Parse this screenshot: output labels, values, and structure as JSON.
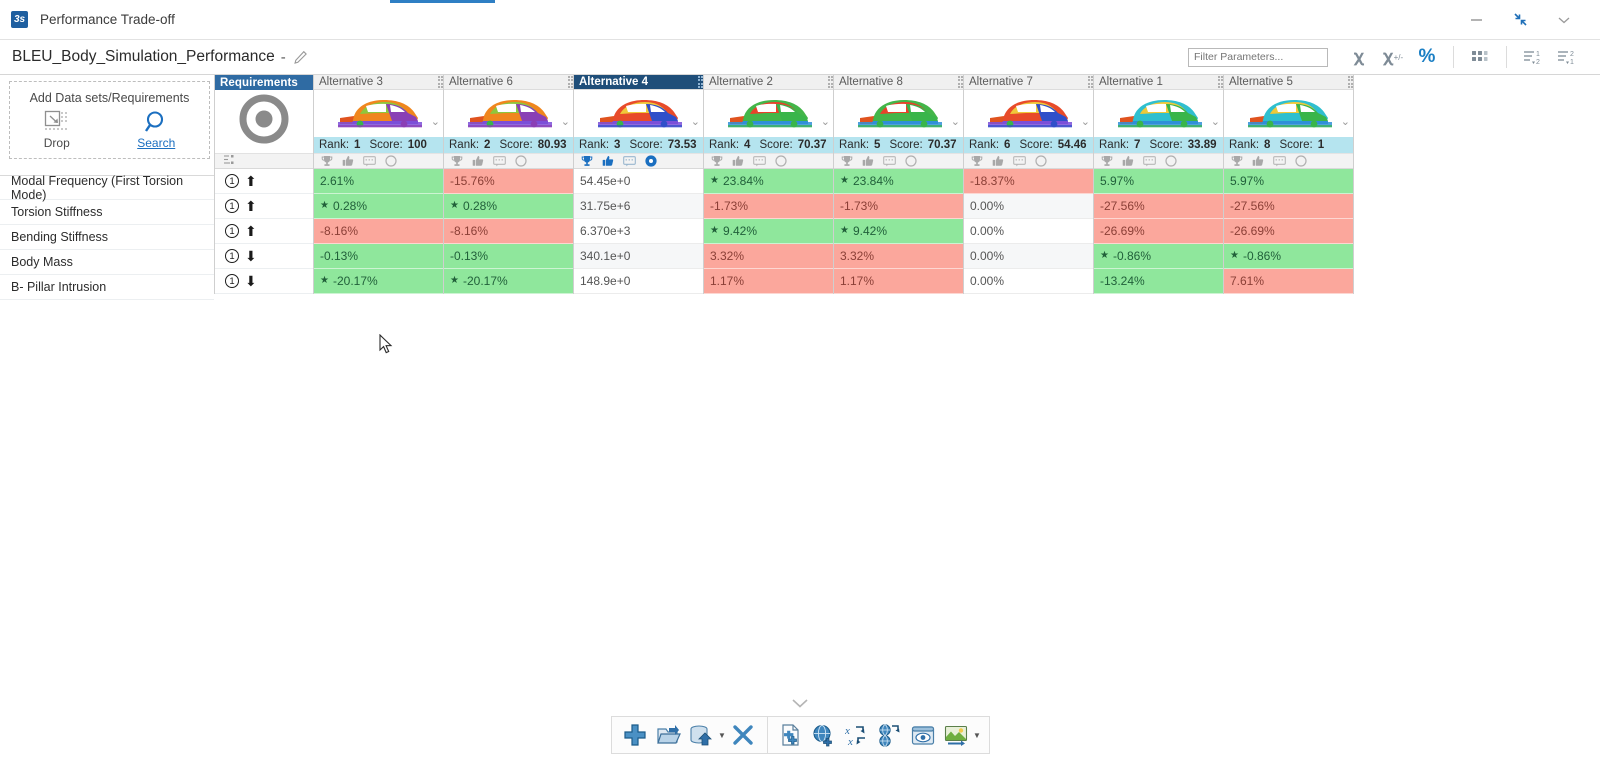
{
  "window": {
    "app_icon": "app-icon",
    "title": "Performance Trade-off",
    "controls": {
      "minimize": "minimize-icon",
      "restore": "restore-icon",
      "more": "chevron-down-icon"
    }
  },
  "document": {
    "title": "BLEU_Body_Simulation_Performance",
    "separator": "-",
    "edit_icon": "pencil-icon"
  },
  "toolbar": {
    "filter_placeholder": "Filter Parameters...",
    "filter_value": "",
    "buttons": [
      {
        "name": "show-absolute-values-button",
        "label": "χ",
        "active": false
      },
      {
        "name": "show-signed-values-button",
        "label": "χ",
        "sup": "+/-",
        "active": false
      },
      {
        "name": "show-percent-values-button",
        "label": "%",
        "active": true
      },
      {
        "name": "matrix-view-button",
        "label": "matrix-icon",
        "active": false
      },
      {
        "name": "sort-ascending-button",
        "label": "sort-asc-icon",
        "active": false
      },
      {
        "name": "sort-descending-button",
        "label": "sort-desc-icon",
        "active": false
      }
    ]
  },
  "dropzone": {
    "title": "Add Data sets/Requirements",
    "drop_label": "Drop",
    "drop_icon": "drop-target-icon",
    "search_label": "Search",
    "search_icon": "search-icon"
  },
  "requirements_column": {
    "header": "Requirements",
    "target_icon": "bullseye-target-icon",
    "legend_icon": "chart-legend-icon"
  },
  "parameters": [
    {
      "name": "Modal Frequency (First Torsion Mode)",
      "priority": "1",
      "direction": "up"
    },
    {
      "name": "Torsion Stiffness",
      "priority": "1",
      "direction": "up"
    },
    {
      "name": "Bending Stiffness",
      "priority": "1",
      "direction": "up"
    },
    {
      "name": "Body Mass",
      "priority": "1",
      "direction": "down"
    },
    {
      "name": "B- Pillar Intrusion",
      "priority": "1",
      "direction": "down"
    }
  ],
  "alternatives": [
    {
      "title": "Alternative 3",
      "rank_label": "Rank:",
      "rank": "1",
      "score_label": "Score:",
      "score": "100",
      "selected": false,
      "car_palette": [
        "#f0861e",
        "#8fc63d",
        "#8a3fb5",
        "#7b4fd8",
        "#e0531f",
        "#39b54a"
      ],
      "values": [
        {
          "text": "2.61%",
          "state": "pos",
          "star": false
        },
        {
          "text": "0.28%",
          "state": "pos",
          "star": true
        },
        {
          "text": "-8.16%",
          "state": "neg",
          "star": false
        },
        {
          "text": "-0.13%",
          "state": "pos",
          "star": false
        },
        {
          "text": "-20.17%",
          "state": "pos",
          "star": true
        }
      ]
    },
    {
      "title": "Alternative 6",
      "rank_label": "Rank:",
      "rank": "2",
      "score_label": "Score:",
      "score": "80.93",
      "selected": false,
      "car_palette": [
        "#f0861e",
        "#8fc63d",
        "#8a3fb5",
        "#7b4fd8",
        "#e0531f",
        "#39b54a"
      ],
      "values": [
        {
          "text": "-15.76%",
          "state": "neg",
          "star": false
        },
        {
          "text": "0.28%",
          "state": "pos",
          "star": true
        },
        {
          "text": "-8.16%",
          "state": "neg",
          "star": false
        },
        {
          "text": "-0.13%",
          "state": "pos",
          "star": false
        },
        {
          "text": "-20.17%",
          "state": "pos",
          "star": true
        }
      ]
    },
    {
      "title": "Alternative 4",
      "rank_label": "Rank:",
      "rank": "3",
      "score_label": "Score:",
      "score": "73.53",
      "selected": true,
      "car_palette": [
        "#e84b2a",
        "#efc93a",
        "#2f4fc9",
        "#7b4fd8",
        "#e0531f",
        "#39b54a"
      ],
      "values": [
        {
          "text": "54.45e+0",
          "state": "neutral",
          "star": false
        },
        {
          "text": "31.75e+6",
          "state": "neutral",
          "star": false
        },
        {
          "text": "6.370e+3",
          "state": "neutral",
          "star": false
        },
        {
          "text": "340.1e+0",
          "state": "neutral",
          "star": false
        },
        {
          "text": "148.9e+0",
          "state": "neutral",
          "star": false
        }
      ]
    },
    {
      "title": "Alternative 2",
      "rank_label": "Rank:",
      "rank": "4",
      "score_label": "Score:",
      "score": "70.37",
      "selected": false,
      "car_palette": [
        "#43b649",
        "#e8412a",
        "#39b54a",
        "#2f8fd8",
        "#e0531f",
        "#39b54a"
      ],
      "values": [
        {
          "text": "23.84%",
          "state": "pos",
          "star": true
        },
        {
          "text": "-1.73%",
          "state": "neg",
          "star": false
        },
        {
          "text": "9.42%",
          "state": "pos",
          "star": true
        },
        {
          "text": "3.32%",
          "state": "neg",
          "star": false
        },
        {
          "text": "1.17%",
          "state": "neg",
          "star": false
        }
      ]
    },
    {
      "title": "Alternative 8",
      "rank_label": "Rank:",
      "rank": "5",
      "score_label": "Score:",
      "score": "70.37",
      "selected": false,
      "car_palette": [
        "#43b649",
        "#e8412a",
        "#39b54a",
        "#2f8fd8",
        "#e0531f",
        "#39b54a"
      ],
      "values": [
        {
          "text": "23.84%",
          "state": "pos",
          "star": true
        },
        {
          "text": "-1.73%",
          "state": "neg",
          "star": false
        },
        {
          "text": "9.42%",
          "state": "pos",
          "star": true
        },
        {
          "text": "3.32%",
          "state": "neg",
          "star": false
        },
        {
          "text": "1.17%",
          "state": "neg",
          "star": false
        }
      ]
    },
    {
      "title": "Alternative 7",
      "rank_label": "Rank:",
      "rank": "6",
      "score_label": "Score:",
      "score": "54.46",
      "selected": false,
      "car_palette": [
        "#e84b2a",
        "#efc93a",
        "#2f4fc9",
        "#7b4fd8",
        "#e0531f",
        "#39b54a"
      ],
      "values": [
        {
          "text": "-18.37%",
          "state": "neg",
          "star": false
        },
        {
          "text": "0.00%",
          "state": "neutral",
          "star": false
        },
        {
          "text": "0.00%",
          "state": "neutral",
          "star": false
        },
        {
          "text": "0.00%",
          "state": "neutral",
          "star": false
        },
        {
          "text": "0.00%",
          "state": "neutral",
          "star": false
        }
      ]
    },
    {
      "title": "Alternative 1",
      "rank_label": "Rank:",
      "rank": "7",
      "score_label": "Score:",
      "score": "33.89",
      "selected": false,
      "car_palette": [
        "#2fbfcf",
        "#efc93a",
        "#39b54a",
        "#2f8fd8",
        "#e0531f",
        "#39b54a"
      ],
      "values": [
        {
          "text": "5.97%",
          "state": "pos",
          "star": false
        },
        {
          "text": "-27.56%",
          "state": "neg",
          "star": false
        },
        {
          "text": "-26.69%",
          "state": "neg",
          "star": false
        },
        {
          "text": "-0.86%",
          "state": "pos",
          "star": true
        },
        {
          "text": "-13.24%",
          "state": "pos",
          "star": false
        }
      ]
    },
    {
      "title": "Alternative 5",
      "rank_label": "Rank:",
      "rank": "8",
      "score_label": "Score:",
      "score": "1",
      "selected": false,
      "car_palette": [
        "#2fbfcf",
        "#efc93a",
        "#39b54a",
        "#2f8fd8",
        "#e0531f",
        "#39b54a"
      ],
      "values": [
        {
          "text": "5.97%",
          "state": "pos",
          "star": false
        },
        {
          "text": "-27.56%",
          "state": "neg",
          "star": false
        },
        {
          "text": "-26.69%",
          "state": "neg",
          "star": false
        },
        {
          "text": "-0.86%",
          "state": "pos",
          "star": true
        },
        {
          "text": "7.61%",
          "state": "neg",
          "star": false
        }
      ]
    }
  ],
  "alt_header_icons": [
    "trophy-icon",
    "thumbs-up-icon",
    "comment-icon",
    "radio-select-icon"
  ],
  "bottom_toolbar": {
    "expand_icon": "chevron-down-icon",
    "group1": [
      {
        "name": "add-button",
        "icon": "plus-icon",
        "caret": false
      },
      {
        "name": "open-button",
        "icon": "open-folder-icon",
        "caret": false
      },
      {
        "name": "import-database-button",
        "icon": "database-upload-icon",
        "caret": true
      },
      {
        "name": "delete-button",
        "icon": "close-x-icon",
        "caret": false
      }
    ],
    "group2": [
      {
        "name": "new-document-button",
        "icon": "new-document-icon",
        "caret": false
      },
      {
        "name": "new-web-resource-button",
        "icon": "globe-add-icon",
        "caret": false
      },
      {
        "name": "swap-variables-button",
        "icon": "swap-xx-icon",
        "caret": false
      },
      {
        "name": "swap-resource-button",
        "icon": "globe-swap-icon",
        "caret": false
      },
      {
        "name": "preview-button",
        "icon": "eye-preview-icon",
        "caret": false
      },
      {
        "name": "image-swap-button",
        "icon": "image-swap-icon",
        "caret": true
      }
    ]
  },
  "colors": {
    "positive_bg": "#8fe79c",
    "negative_bg": "#fba79c",
    "selected_header": "#1f4e79",
    "requirements_header": "#2f6ba3",
    "rank_bar": "#b5e4ef",
    "accent": "#1b7fc4"
  }
}
